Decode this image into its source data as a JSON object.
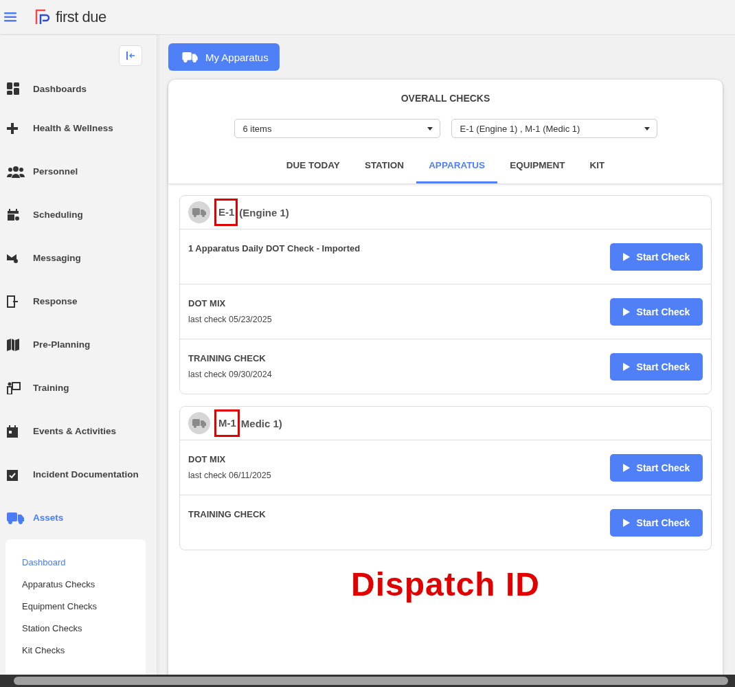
{
  "header": {
    "logo_text": "first due"
  },
  "sidebar": {
    "items": [
      {
        "label": "Dashboards",
        "selected": false
      },
      {
        "label": "Health & Wellness",
        "selected": false
      },
      {
        "label": "Personnel",
        "selected": false
      },
      {
        "label": "Scheduling",
        "selected": false
      },
      {
        "label": "Messaging",
        "selected": false
      },
      {
        "label": "Response",
        "selected": false
      },
      {
        "label": "Pre-Planning",
        "selected": false
      },
      {
        "label": "Training",
        "selected": false
      },
      {
        "label": "Events & Activities",
        "selected": false
      },
      {
        "label": "Incident Documentation",
        "selected": false
      },
      {
        "label": "Assets",
        "selected": true,
        "expanded": true,
        "children": [
          {
            "label": "Dashboard",
            "selected": true
          },
          {
            "label": "Apparatus Checks",
            "selected": false
          },
          {
            "label": "Equipment Checks",
            "selected": false
          },
          {
            "label": "Station Checks",
            "selected": false
          },
          {
            "label": "Kit Checks",
            "selected": false
          }
        ]
      }
    ]
  },
  "main": {
    "my_apparatus_button": "My Apparatus",
    "panel": {
      "title": "OVERALL CHECKS",
      "filters": [
        {
          "value": "6 items"
        },
        {
          "value": "E-1 (Engine 1) , M-1 (Medic 1)"
        }
      ],
      "tabs": [
        {
          "label": "DUE TODAY",
          "selected": false
        },
        {
          "label": "STATION",
          "selected": false
        },
        {
          "label": "APPARATUS",
          "selected": true
        },
        {
          "label": "EQUIPMENT",
          "selected": false
        },
        {
          "label": "KIT",
          "selected": false
        }
      ],
      "groups": [
        {
          "id": "E-1",
          "name": "(Engine 1)",
          "highlighted": true,
          "checks": [
            {
              "name": "1 Apparatus Daily DOT Check - Imported",
              "button": "Start Check"
            },
            {
              "name": "DOT MIX",
              "last_check": "last check 05/23/2025",
              "button": "Start Check"
            },
            {
              "name": "TRAINING CHECK",
              "last_check": "last check 09/30/2024",
              "button": "Start Check"
            }
          ]
        },
        {
          "id": "M-1",
          "name": "Medic 1)",
          "highlighted": true,
          "checks": [
            {
              "name": "DOT MIX",
              "last_check": "last check 06/11/2025",
              "button": "Start Check"
            },
            {
              "name": "TRAINING CHECK",
              "button": "Start Check"
            }
          ]
        }
      ]
    }
  },
  "annotation": {
    "label": "Dispatch ID"
  }
}
